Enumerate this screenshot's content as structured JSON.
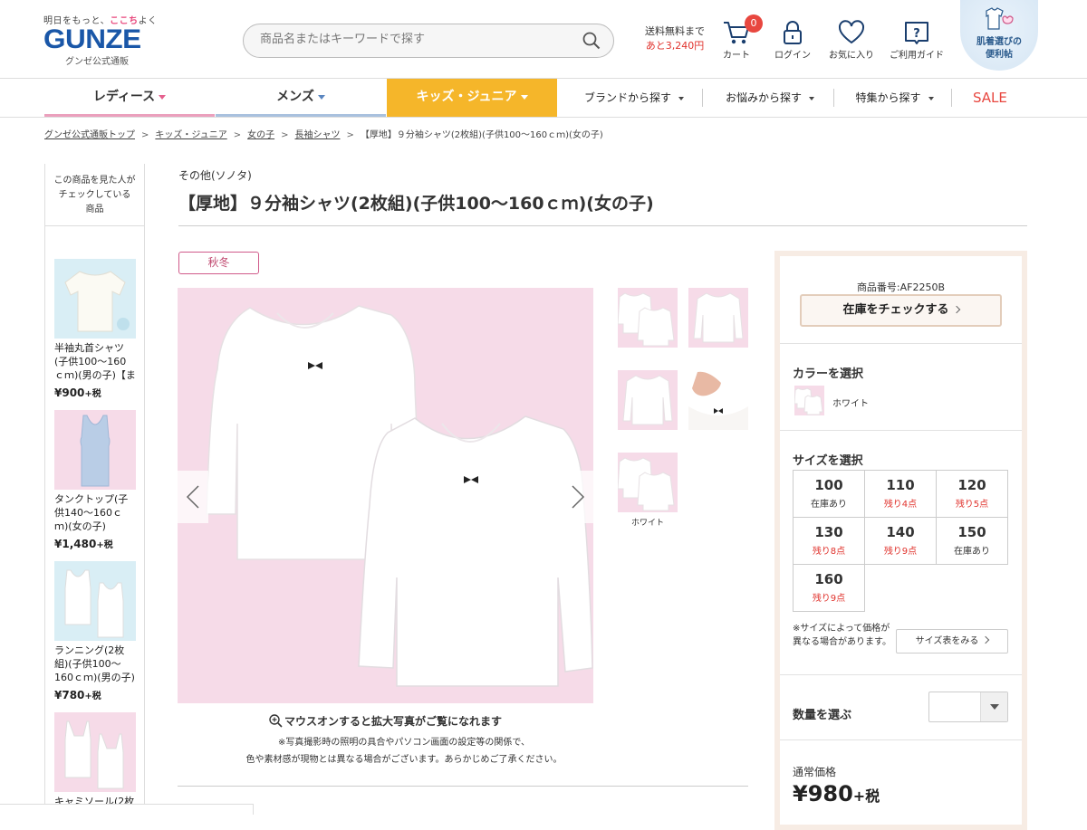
{
  "header": {
    "tagline_pre": "明日をもっと、",
    "tagline_mid": "ここち",
    "tagline_post": "よく",
    "logo": "GUNZE",
    "logo_sub": "グンゼ公式通販",
    "search_placeholder": "商品名またはキーワードで探す",
    "shipping_line1": "送料無料まで",
    "shipping_line2": "あと3,240円",
    "cart_label": "カート",
    "cart_count": "0",
    "login_label": "ログイン",
    "favorites_label": "お気に入り",
    "guide_label": "ご利用ガイド",
    "innerwear_guide": "肌着選びの\n便利帖"
  },
  "nav": {
    "ladies": "レディース",
    "mens": "メンズ",
    "kids": "キッズ・ジュニア",
    "brand": "ブランドから探す",
    "concern": "お悩みから探す",
    "feature": "特集から探す",
    "sale": "SALE"
  },
  "breadcrumb": [
    "グンゼ公式通販トップ",
    "キッズ・ジュニア",
    "女の子",
    "長袖シャツ"
  ],
  "breadcrumb_current": "【厚地】９分袖シャツ(2枚組)(子供100〜160ｃｍ)(女の子)",
  "sidebar": {
    "heading": "この商品を見た人が\nチェックしている\n商品",
    "items": [
      {
        "name": "半袖丸首シャツ(子供100〜160ｃｍ)(男の子)【ま",
        "price": "¥900",
        "tax": "+税"
      },
      {
        "name": "タンクトップ(子供140〜160ｃｍ)(女の子)",
        "price": "¥1,480",
        "tax": "+税"
      },
      {
        "name": "ランニング(2枚組)(子供100〜160ｃｍ)(男の子)",
        "price": "¥780",
        "tax": "+税"
      },
      {
        "name": "キャミソール(2枚",
        "price": "",
        "tax": ""
      }
    ]
  },
  "product": {
    "maker": "その他(ソノタ)",
    "title": "【厚地】９分袖シャツ(2枚組)(子供100〜160ｃｍ)(女の子)",
    "season_tag": "秋冬",
    "thumb_caption": "ホワイト",
    "zoom_note": "マウスオンすると拡大写真がご覧になれます",
    "photo_note_1": "※写真撮影時の照明の具合やパソコン画面の設定等の関係で、",
    "photo_note_2": "色や素材感が現物とは異なる場合がございます。あらかじめご了承ください。"
  },
  "panel": {
    "product_code": "商品番号:AF2250B",
    "stock_check": "在庫をチェックする",
    "color_heading": "カラーを選択",
    "color_name": "ホワイト",
    "size_heading": "サイズを選択",
    "sizes": [
      {
        "size": "100",
        "stock": "在庫あり"
      },
      {
        "size": "110",
        "stock": "残り4点"
      },
      {
        "size": "120",
        "stock": "残り5点"
      },
      {
        "size": "130",
        "stock": "残り8点"
      },
      {
        "size": "140",
        "stock": "残り9点"
      },
      {
        "size": "150",
        "stock": "在庫あり"
      },
      {
        "size": "160",
        "stock": "残り9点"
      }
    ],
    "size_note": "※サイズによって価格が異なる場合があります。",
    "size_chart": "サイズ表をみる",
    "qty_label": "数量を選ぶ",
    "qty_value": "",
    "price_label": "通常価格",
    "price": "¥980",
    "price_tax": "+税"
  },
  "colors": {
    "brand_blue": "#1a57a8",
    "ladies_pink": "#eba0bd",
    "mens_blue": "#a9c1de",
    "kids_orange": "#f5b62a",
    "sale_red": "#e8473f",
    "low_stock_red": "#e0322c",
    "product_bg": "#f6dbe8"
  }
}
